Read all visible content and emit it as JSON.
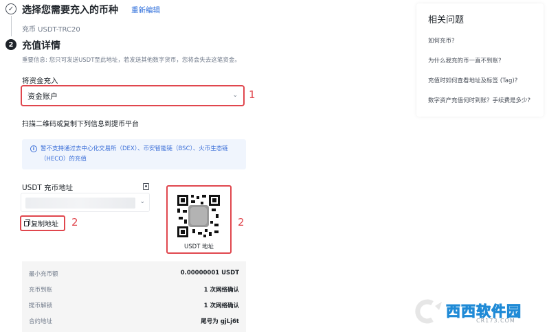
{
  "step1": {
    "index": "✓",
    "title": "选择您需要充入的币种",
    "edit_label": "重新编辑",
    "subtitle": "充币 USDT-TRC20"
  },
  "step2": {
    "index": "2",
    "title": "充值详情",
    "notice": "重要信息: 您只可发送USDT至此地址，若发送其他数字货币，您将会失去这笔资金。"
  },
  "fund": {
    "label": "将资金充入",
    "selected": "资金账户"
  },
  "scan_label": "扫描二维码或复制下列信息到提币平台",
  "info": {
    "icon": "info-icon",
    "text": "暂不支持通过去中心化交易所（DEX）、币安智能链（BSC）、火币生态链（HECO）的充值"
  },
  "address": {
    "label": "USDT 充币地址",
    "copy_label": "复制地址",
    "qr_label": "USDT 地址"
  },
  "annotations": {
    "a1": "1",
    "a2": "2",
    "a3": "2"
  },
  "details": [
    {
      "key": "最小充币额",
      "value": "0.00000001 USDT"
    },
    {
      "key": "充币到账",
      "value": "1 次网络确认"
    },
    {
      "key": "提币解锁",
      "value": "1 次网络确认"
    },
    {
      "key": "合约地址",
      "value": "尾号为 gjLj6t"
    }
  ],
  "related": {
    "title": "相关问题",
    "items": [
      "如何充币?",
      "为什么我充的币一直不到账?",
      "充值时如何查看地址及标签 (Tag)?",
      "数字资产充值何时到账？手续费是多少?"
    ]
  },
  "watermark": {
    "main": "西西软件园",
    "sub": "CR173.COM"
  },
  "colors": {
    "accent": "#2f6fdb",
    "highlight": "#e0464d",
    "info_bg": "#f0f5fd"
  }
}
